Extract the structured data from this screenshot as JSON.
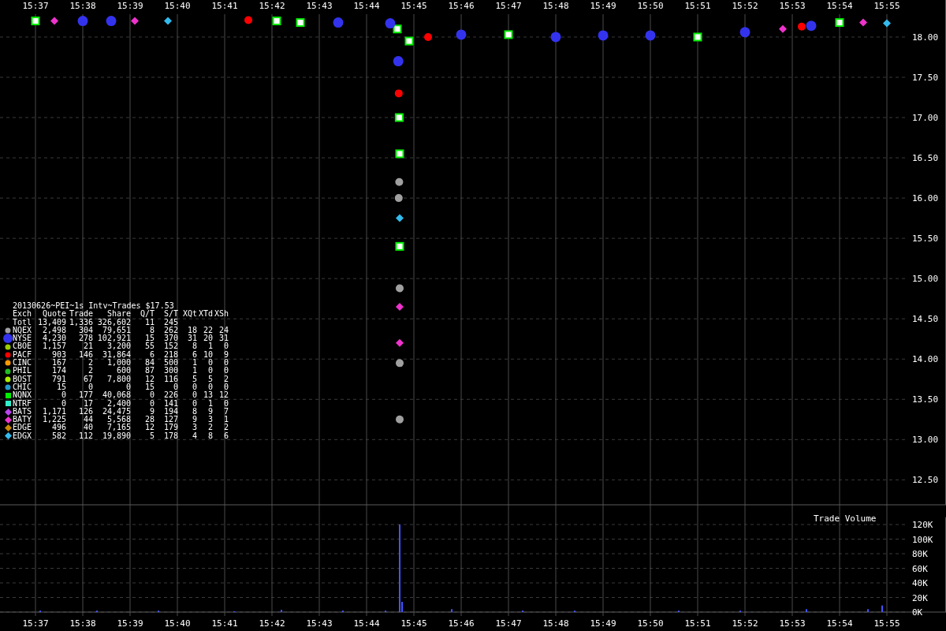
{
  "legend": {
    "title": "20130626~PEI~1s Intv~Trades $17.53",
    "columns": [
      "Exch",
      "Quote",
      "Trade",
      "Share",
      "Q/T",
      "S/T",
      "XQt",
      "XTd",
      "XSh"
    ],
    "total": {
      "name": "Totl",
      "cells": [
        "13,409",
        "1,336",
        "326,602",
        "11",
        "245"
      ]
    },
    "exchanges": [
      {
        "name": "NQEX",
        "kind": "circle",
        "color": "#a0a0a0",
        "cells": [
          "2,498",
          "304",
          "79,651",
          "8",
          "262",
          "18",
          "22",
          "24"
        ]
      },
      {
        "name": "NYSE",
        "kind": "big-circle",
        "color": "#3333ee",
        "cells": [
          "4,230",
          "278",
          "102,921",
          "15",
          "370",
          "31",
          "20",
          "31"
        ]
      },
      {
        "name": "CBOE",
        "kind": "circle",
        "color": "#99cc00",
        "cells": [
          "1,157",
          "21",
          "3,200",
          "55",
          "152",
          "8",
          "1",
          "0"
        ]
      },
      {
        "name": "PACF",
        "kind": "circle",
        "color": "#ff0000",
        "cells": [
          "903",
          "146",
          "31,864",
          "6",
          "218",
          "6",
          "10",
          "9"
        ]
      },
      {
        "name": "CINC",
        "kind": "circle",
        "color": "#ff9900",
        "cells": [
          "167",
          "2",
          "1,000",
          "84",
          "500",
          "1",
          "0",
          "0"
        ]
      },
      {
        "name": "PHIL",
        "kind": "circle",
        "color": "#22bb22",
        "cells": [
          "174",
          "2",
          "600",
          "87",
          "300",
          "1",
          "0",
          "0"
        ]
      },
      {
        "name": "BOST",
        "kind": "circle",
        "color": "#aaee00",
        "cells": [
          "791",
          "67",
          "7,800",
          "12",
          "116",
          "5",
          "5",
          "2"
        ]
      },
      {
        "name": "CHIC",
        "kind": "circle",
        "color": "#2299cc",
        "cells": [
          "15",
          "0",
          "0",
          "15",
          "0",
          "0",
          "0",
          "0"
        ]
      },
      {
        "name": "NQNX",
        "kind": "square",
        "color": "#00ee00",
        "cells": [
          "0",
          "177",
          "40,068",
          "0",
          "226",
          "0",
          "13",
          "12"
        ]
      },
      {
        "name": "NTRF",
        "kind": "square",
        "color": "#33eecc",
        "cells": [
          "0",
          "17",
          "2,400",
          "0",
          "141",
          "0",
          "1",
          "0"
        ]
      },
      {
        "name": "BATS",
        "kind": "diamond",
        "color": "#bb44ee",
        "cells": [
          "1,171",
          "126",
          "24,475",
          "9",
          "194",
          "8",
          "9",
          "7"
        ]
      },
      {
        "name": "BATY",
        "kind": "diamond",
        "color": "#ee33cc",
        "cells": [
          "1,225",
          "44",
          "5,568",
          "28",
          "127",
          "9",
          "3",
          "1"
        ]
      },
      {
        "name": "EDGE",
        "kind": "diamond",
        "color": "#cc8800",
        "cells": [
          "496",
          "40",
          "7,165",
          "12",
          "179",
          "3",
          "2",
          "2"
        ]
      },
      {
        "name": "EDGX",
        "kind": "diamond",
        "color": "#33bbee",
        "cells": [
          "582",
          "112",
          "19,890",
          "5",
          "178",
          "4",
          "8",
          "6"
        ]
      }
    ]
  },
  "price_chart": {
    "chart_data": {
      "type": "scatter",
      "x": [
        937.0,
        937.4,
        938.0,
        938.6,
        939.1,
        939.8,
        941.5,
        942.1,
        942.6,
        943.4,
        944.5,
        944.65,
        944.67,
        944.68,
        944.69,
        944.7,
        944.69,
        944.68,
        944.7,
        944.7,
        944.7,
        944.7,
        944.7,
        944.7,
        944.7,
        944.9,
        945.3,
        946.0,
        947.0,
        948.0,
        949.0,
        950.0,
        951.0,
        952.0,
        952.8,
        953.2,
        953.4,
        954.0,
        954.5,
        955.0
      ],
      "series": [
        {
          "color": "#00ee00",
          "values": [
            18.2,
            null,
            null,
            null,
            null,
            null,
            null,
            18.2,
            18.18,
            null,
            null,
            18.1,
            null,
            null,
            17.0,
            16.55,
            null,
            null,
            null,
            15.4,
            null,
            null,
            null,
            null,
            null,
            17.95,
            null,
            null,
            18.03,
            null,
            null,
            null,
            18.0,
            null,
            null,
            null,
            null,
            18.18,
            null,
            null
          ]
        },
        {
          "color": "#3333ee",
          "values": [
            null,
            null,
            18.2,
            18.2,
            null,
            null,
            null,
            null,
            null,
            18.18,
            18.17,
            null,
            17.7,
            null,
            null,
            null,
            null,
            null,
            null,
            null,
            null,
            null,
            null,
            null,
            null,
            null,
            null,
            18.03,
            null,
            18.0,
            18.02,
            18.02,
            null,
            18.06,
            null,
            null,
            18.14,
            null,
            null,
            null
          ]
        },
        {
          "color": "#a0a0a0",
          "values": [
            null,
            null,
            null,
            null,
            null,
            null,
            null,
            null,
            null,
            null,
            null,
            null,
            null,
            null,
            null,
            null,
            16.2,
            16.0,
            null,
            null,
            14.88,
            null,
            null,
            13.95,
            13.25,
            null,
            null,
            null,
            null,
            null,
            null,
            null,
            null,
            null,
            null,
            null,
            null,
            null,
            null,
            null
          ]
        },
        {
          "color": "#ff0000",
          "values": [
            null,
            null,
            null,
            null,
            null,
            null,
            18.21,
            null,
            null,
            null,
            null,
            null,
            null,
            17.3,
            null,
            null,
            null,
            null,
            null,
            null,
            null,
            null,
            null,
            null,
            null,
            null,
            18.0,
            null,
            null,
            null,
            null,
            null,
            null,
            null,
            null,
            18.13,
            null,
            null,
            null,
            null
          ]
        },
        {
          "color": "#ee33cc",
          "values": [
            null,
            18.2,
            null,
            null,
            18.2,
            null,
            null,
            null,
            null,
            null,
            null,
            null,
            null,
            null,
            null,
            null,
            null,
            null,
            null,
            null,
            null,
            14.65,
            14.2,
            null,
            null,
            null,
            null,
            null,
            null,
            null,
            null,
            null,
            null,
            null,
            18.1,
            null,
            null,
            null,
            18.18,
            null
          ]
        },
        {
          "color": "#33bbee",
          "values": [
            null,
            null,
            null,
            null,
            null,
            18.2,
            null,
            null,
            null,
            null,
            null,
            null,
            null,
            null,
            null,
            null,
            null,
            null,
            15.75,
            null,
            null,
            null,
            null,
            null,
            null,
            null,
            null,
            null,
            null,
            null,
            null,
            null,
            null,
            null,
            null,
            null,
            null,
            null,
            null,
            18.17
          ]
        }
      ],
      "xlim": [
        936.25,
        956.25
      ],
      "ylim": [
        12.19,
        18.46
      ],
      "grid": true,
      "xticks": [
        {
          "value": 937,
          "label": "15:37"
        },
        {
          "value": 938,
          "label": "15:38"
        },
        {
          "value": 939,
          "label": "15:39"
        },
        {
          "value": 940,
          "label": "15:40"
        },
        {
          "value": 941,
          "label": "15:41"
        },
        {
          "value": 942,
          "label": "15:42"
        },
        {
          "value": 943,
          "label": "15:43"
        },
        {
          "value": 944,
          "label": "15:44"
        },
        {
          "value": 945,
          "label": "15:45"
        },
        {
          "value": 946,
          "label": "15:46"
        },
        {
          "value": 947,
          "label": "15:47"
        },
        {
          "value": 948,
          "label": "15:48"
        },
        {
          "value": 949,
          "label": "15:49"
        },
        {
          "value": 950,
          "label": "15:50"
        },
        {
          "value": 951,
          "label": "15:51"
        },
        {
          "value": 952,
          "label": "15:52"
        },
        {
          "value": 953,
          "label": "15:53"
        },
        {
          "value": 954,
          "label": "15:54"
        },
        {
          "value": 955,
          "label": "15:55"
        }
      ],
      "yticks": [
        {
          "value": 18,
          "label": "18.00"
        },
        {
          "value": 17.5,
          "label": "17.50"
        },
        {
          "value": 17,
          "label": "17.00"
        },
        {
          "value": 16.5,
          "label": "16.50"
        },
        {
          "value": 16,
          "label": "16.00"
        },
        {
          "value": 15.5,
          "label": "15.50"
        },
        {
          "value": 15,
          "label": "15.00"
        },
        {
          "value": 14.5,
          "label": "14.50"
        },
        {
          "value": 14,
          "label": "14.00"
        },
        {
          "value": 13.5,
          "label": "13.50"
        },
        {
          "value": 13,
          "label": "13.00"
        },
        {
          "value": 12.5,
          "label": "12.50"
        }
      ]
    }
  },
  "volume_chart": {
    "chart_data": {
      "type": "bar",
      "title": "Trade Volume",
      "x": [
        937.1,
        938.3,
        939.6,
        941.2,
        942.2,
        943.5,
        944.4,
        944.7,
        944.75,
        945.8,
        947.3,
        948.4,
        950.6,
        951.9,
        953.3,
        954.6,
        954.9
      ],
      "series": [
        {
          "color": "#4455ff",
          "values": [
            2000,
            2000,
            2000,
            1000,
            3000,
            2000,
            2000,
            120000,
            14000,
            4000,
            2000,
            2000,
            2000,
            2000,
            4000,
            4000,
            9000
          ]
        }
      ],
      "xlim": [
        936.25,
        956.25
      ],
      "ylim": [
        0,
        130000
      ],
      "grid": true,
      "xticks": [
        {
          "value": 937,
          "label": "15:37"
        },
        {
          "value": 938,
          "label": "15:38"
        },
        {
          "value": 939,
          "label": "15:39"
        },
        {
          "value": 940,
          "label": "15:40"
        },
        {
          "value": 941,
          "label": "15:41"
        },
        {
          "value": 942,
          "label": "15:42"
        },
        {
          "value": 943,
          "label": "15:43"
        },
        {
          "value": 944,
          "label": "15:44"
        },
        {
          "value": 945,
          "label": "15:45"
        },
        {
          "value": 946,
          "label": "15:46"
        },
        {
          "value": 947,
          "label": "15:47"
        },
        {
          "value": 948,
          "label": "15:48"
        },
        {
          "value": 949,
          "label": "15:49"
        },
        {
          "value": 950,
          "label": "15:50"
        },
        {
          "value": 951,
          "label": "15:51"
        },
        {
          "value": 952,
          "label": "15:52"
        },
        {
          "value": 953,
          "label": "15:53"
        },
        {
          "value": 954,
          "label": "15:54"
        },
        {
          "value": 955,
          "label": "15:55"
        }
      ],
      "yticks": [
        {
          "value": 0,
          "label": "0K"
        },
        {
          "value": 20000,
          "label": "20K"
        },
        {
          "value": 40000,
          "label": "40K"
        },
        {
          "value": 60000,
          "label": "60K"
        },
        {
          "value": 80000,
          "label": "80K"
        },
        {
          "value": 100000,
          "label": "100K"
        },
        {
          "value": 120000,
          "label": "120K"
        }
      ]
    }
  }
}
